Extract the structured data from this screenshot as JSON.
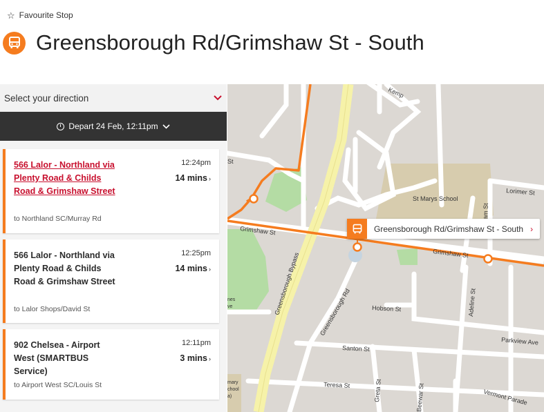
{
  "favourite": {
    "label": "Favourite Stop",
    "icon": "star-outline-icon"
  },
  "page": {
    "title": "Greensborough Rd/Grimshaw St - South",
    "icon": "bus-icon"
  },
  "direction": {
    "label": "Select your direction",
    "icon": "chevron-down-icon"
  },
  "depart": {
    "label": "Depart 24 Feb, 12:11pm",
    "icon": "clock-icon"
  },
  "colors": {
    "accent": "#f57c1f",
    "link": "#c8102e",
    "dark_bar": "#333333"
  },
  "departures": [
    {
      "route": "566 Lalor - Northland via Plenty Road & Childs Road & Grimshaw Street",
      "to": "to Northland SC/Murray Rd",
      "time": "12:24pm",
      "mins": "14 mins"
    },
    {
      "route": "566 Lalor - Northland via Plenty Road & Childs Road & Grimshaw Street",
      "to": "to Lalor Shops/David St",
      "time": "12:25pm",
      "mins": "14 mins"
    },
    {
      "route": "902 Chelsea - Airport West (SMARTBUS Service)",
      "to": "to Airport West SC/Louis St",
      "time": "12:11pm",
      "mins": "3 mins"
    }
  ],
  "map": {
    "stop_label": "Greensborough Rd/Grimshaw St - South",
    "streets": {
      "kemp": "Kemp",
      "grimshaw_w": "Grimshaw St",
      "grimshaw_e": "Grimshaw St",
      "bypass": "Greensborough Bypass",
      "greensborough_rd": "Greensborough Rd",
      "hobson": "Hobson St",
      "adeline": "Adeline St",
      "lorimer": "Lorimer St",
      "william": "liam St",
      "parkview": "Parkview Ave",
      "santon": "Santon St",
      "teresa": "Teresa St",
      "greta": "Greta St",
      "beewar": "Beewar St",
      "vermont": "Vermont Parade",
      "st_frag": "St"
    },
    "places": {
      "st_marys": "St Marys School",
      "frag1": "nes",
      "frag2": "ve",
      "frag3": "mary",
      "frag4": "chool",
      "frag5": "a)"
    }
  }
}
